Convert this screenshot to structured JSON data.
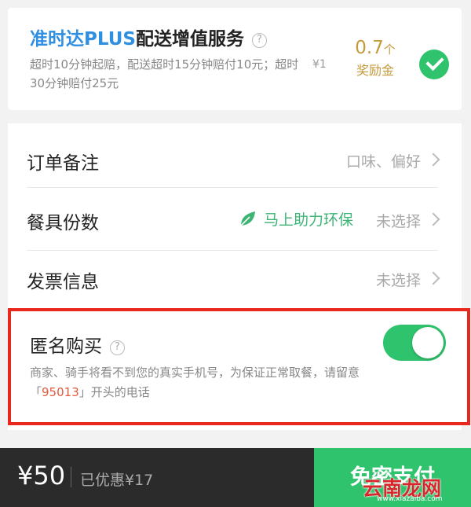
{
  "plus": {
    "brand": "准时达PLUS",
    "title": "配送增值服务",
    "help_icon": "?",
    "desc": "超时10分钟起赔，配送超时15分钟赔付10元；超时30分钟赔付25元",
    "price": "¥1",
    "reward_value": "0.7",
    "reward_unit": "个",
    "reward_label": "奖励金",
    "selected": true
  },
  "rows": [
    {
      "label": "订单备注",
      "value": "口味、偏好"
    },
    {
      "label": "餐具份数",
      "eco": "马上助力环保",
      "value": "未选择"
    },
    {
      "label": "发票信息",
      "value": "未选择"
    }
  ],
  "anonymous": {
    "title": "匿名购买",
    "help_icon": "?",
    "desc_1": "商家、骑手将看不到您的真实手机号，为保证正常取餐，请留意「",
    "number": "95013",
    "desc_2": "」开头的电话",
    "enabled": true
  },
  "footer": {
    "total": "¥50",
    "discount": "已优惠¥17",
    "pay_label": "免密支付"
  },
  "watermark": {
    "text": "云南龙网",
    "sub": "www.xiazaiba.com"
  },
  "colors": {
    "accent_green": "#2fc36d",
    "brand_blue": "#2f8fe0",
    "reward_gold": "#c49a3b",
    "highlight_red": "#e8281e"
  }
}
